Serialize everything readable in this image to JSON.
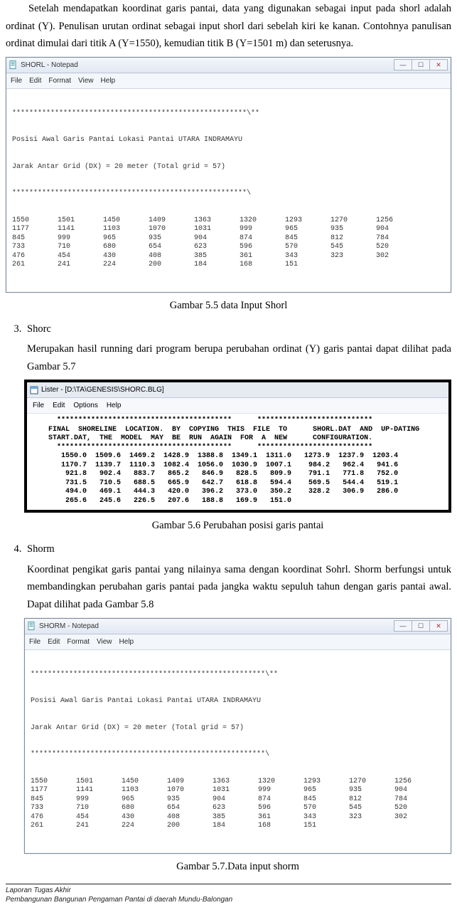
{
  "intro": {
    "line1": "Setelah  mendapatkan  koordinat  garis  pantai,  data  yang  digunakan  sebagai  input",
    "line2": "pada shorl adalah ordinat (Y). Penulisan urutan ordinat sebagai input shorl dari sebelah",
    "line3": "kiri ke kanan. Contohnya panulisan ordinat dimulai dari titik A (Y=1550), kemudian titik",
    "line4": "B (Y=1501 m) dan seterusnya."
  },
  "shorl_window": {
    "title": "SHORL - Notepad",
    "menus": [
      "File",
      "Edit",
      "Format",
      "View",
      "Help"
    ],
    "header1": "Posisi Awal Garis Pantai Lokasi Pantai UTARA INDRAMAYU",
    "header2": "Jarak Antar Grid (DX) = 20 meter (Total grid = 57)",
    "star_top": "*******************************************************\\**",
    "star_mid": "*******************************************************\\",
    "rows": [
      [
        "1550",
        "1501",
        "1450",
        "1409",
        "1363",
        "1320",
        "1293",
        "1270",
        "1256"
      ],
      [
        "1177",
        "1141",
        "1103",
        "1070",
        "1031",
        "999",
        "965",
        "935",
        "904"
      ],
      [
        "845",
        "999",
        "965",
        "935",
        "904",
        "874",
        "845",
        "812",
        "784"
      ],
      [
        "733",
        "710",
        "680",
        "654",
        "623",
        "596",
        "570",
        "545",
        "520"
      ],
      [
        "476",
        "454",
        "430",
        "408",
        "385",
        "361",
        "343",
        "323",
        "302"
      ],
      [
        "261",
        "241",
        "224",
        "200",
        "184",
        "168",
        "151",
        "",
        ""
      ]
    ]
  },
  "caption55": "Gambar 5.5  data Input Shorl",
  "item3": {
    "title": "Shorc",
    "p1": "Merupakan hasil running dari program berupa perubahan ordinat (Y) garis pantai dapat dilihat pada Gambar 5.7"
  },
  "lister_window": {
    "title": "Lister - [D:\\TA\\GENESIS\\SHORC.BLG]",
    "menus": [
      "File",
      "Edit",
      "Options",
      "Help"
    ],
    "client": "  *****************************************      ***************************\nFINAL  SHORELINE  LOCATION.  BY  COPYING  THIS  FILE  TO      SHORL.DAT  AND  UP-DATING\nSTART.DAT,  THE  MODEL  MAY  BE  RUN  AGAIN  FOR  A  NEW      CONFIGURATION.\n  *****************************************      ***************************\n   1550.0  1509.6  1469.2  1428.9  1388.8  1349.1  1311.0   1273.9  1237.9  1203.4\n   1170.7  1139.7  1110.3  1082.4  1056.0  1030.9  1007.1    984.2   962.4   941.6\n    921.8   902.4   883.7   865.2   846.9   828.5   809.9    791.1   771.8   752.0\n    731.5   710.5   688.5   665.9   642.7   618.8   594.4    569.5   544.4   519.1\n    494.0   469.1   444.3   420.0   396.2   373.0   350.2    328.2   306.9   286.0\n    265.6   245.6   226.5   207.6   188.8   169.9   151.0"
  },
  "caption56": "Gambar 5.6 Perubahan posisi garis pantai",
  "item4": {
    "title": "Shorm",
    "p1": "Koordinat pengikat garis pantai yang nilainya sama dengan koordinat Sohrl. Shorm berfungsi untuk membandingkan perubahan garis pantai pada jangka waktu sepuluh tahun dengan garis pantai awal. Dapat dilihat pada Gambar 5.8"
  },
  "shorm_window": {
    "title": "SHORM - Notepad",
    "menus": [
      "File",
      "Edit",
      "Format",
      "View",
      "Help"
    ],
    "header1": "Posisi Awal Garis Pantai Lokasi Pantai UTARA INDRAMAYU",
    "header2": "Jarak Antar Grid (DX) = 20 meter (Total grid = 57)",
    "rows": [
      [
        "1550",
        "1501",
        "1450",
        "1409",
        "1363",
        "1320",
        "1293",
        "1270",
        "1256"
      ],
      [
        "1177",
        "1141",
        "1103",
        "1070",
        "1031",
        "999",
        "965",
        "935",
        "904"
      ],
      [
        "845",
        "999",
        "965",
        "935",
        "904",
        "874",
        "845",
        "812",
        "784"
      ],
      [
        "733",
        "710",
        "680",
        "654",
        "623",
        "596",
        "570",
        "545",
        "520"
      ],
      [
        "476",
        "454",
        "430",
        "408",
        "385",
        "361",
        "343",
        "323",
        "302"
      ],
      [
        "261",
        "241",
        "224",
        "200",
        "184",
        "168",
        "151",
        "",
        ""
      ]
    ]
  },
  "caption57": "Gambar 5.7.Data input shorm",
  "footer": {
    "line1": "Laporan  Tugas Akhir",
    "line2": "Pembangunan Bangunan Pengaman Pantai di daerah Mundu-Balongan"
  },
  "winbtns": {
    "min": "—",
    "max": "☐",
    "close": "✕"
  }
}
